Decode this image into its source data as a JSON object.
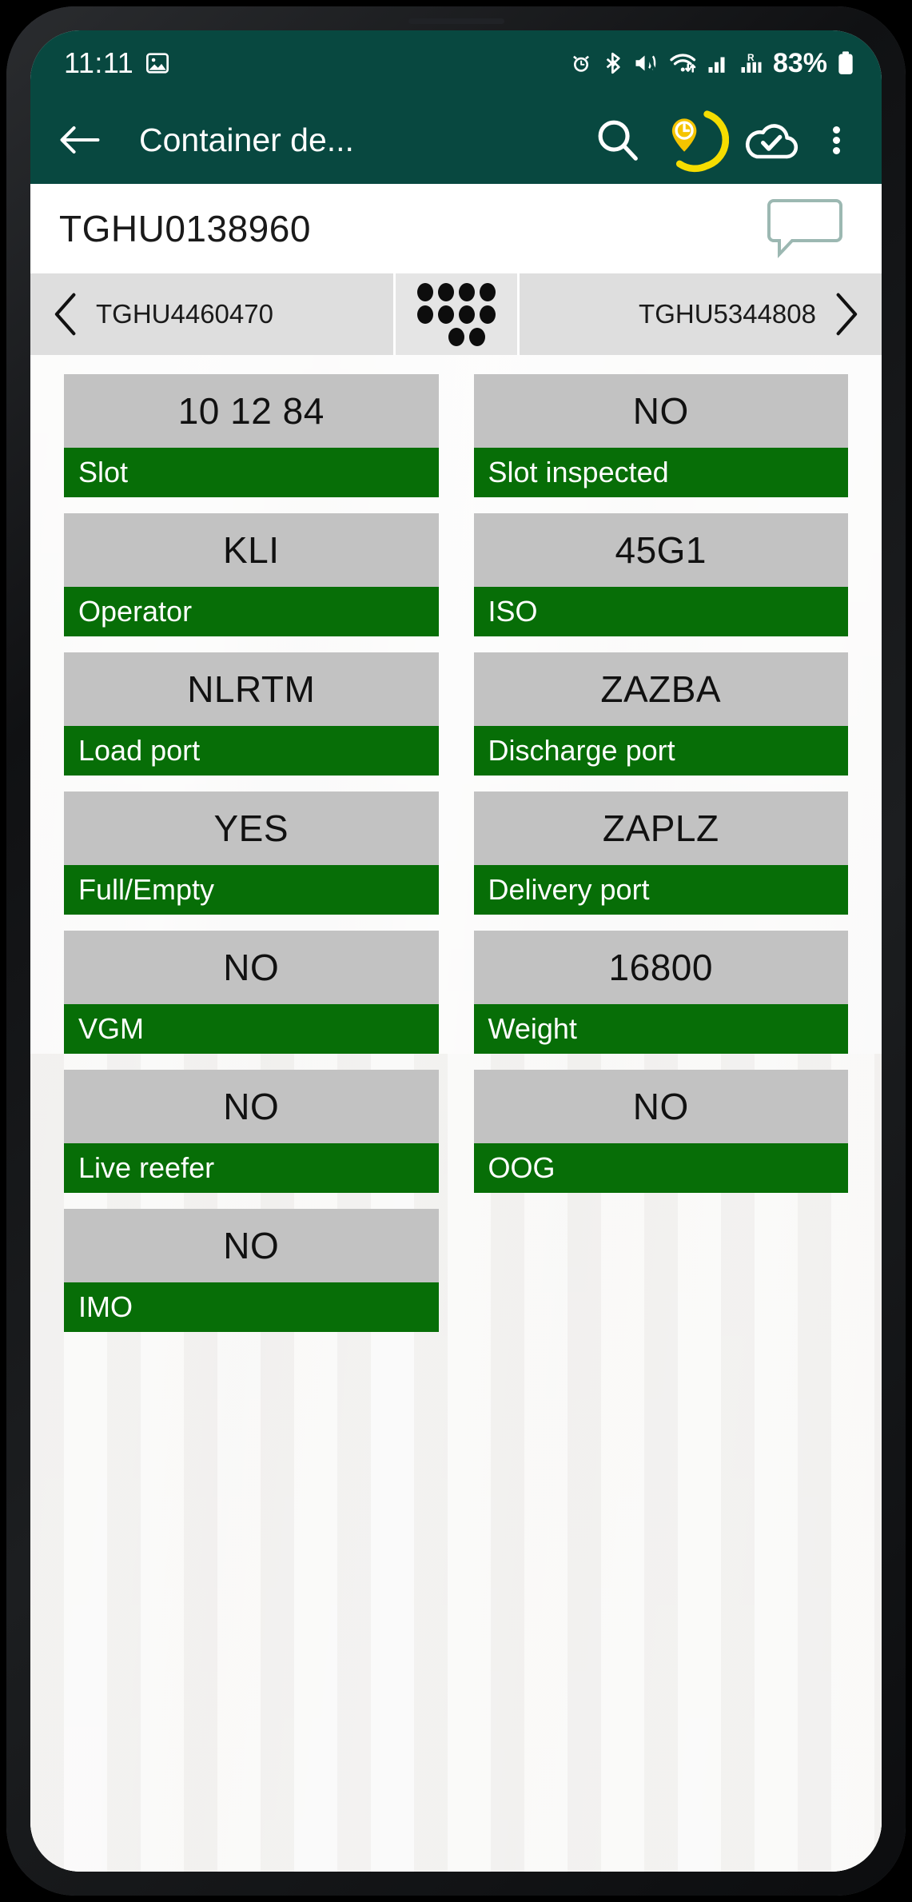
{
  "status_bar": {
    "time": "11:11",
    "battery_percent": "83%",
    "icons": [
      "image-icon",
      "alarm-icon",
      "bluetooth-icon",
      "mute-vibrate-icon",
      "wifi-icon",
      "signal-bars-icon",
      "roaming-signal-icon",
      "battery-icon"
    ]
  },
  "app_bar": {
    "title": "Container de...",
    "icons": [
      "back-arrow-icon",
      "search-icon",
      "location-clock-icon",
      "cloud-check-icon",
      "overflow-menu-icon"
    ],
    "accent_yellow": "#f5dd00",
    "background": "#084840"
  },
  "id_header": {
    "container_id": "TGHU0138960",
    "comment_icon": "speech-bubble-icon"
  },
  "nav_strip": {
    "previous_container": "TGHU4460470",
    "next_container": "TGHU5344808",
    "grid_icon": "dot-grid-icon"
  },
  "theme": {
    "label_green": "#076e07",
    "value_gray": "#c2c2c2",
    "toolbar_teal": "#084840"
  },
  "fields": [
    {
      "label": "Slot",
      "value": "10 12 84"
    },
    {
      "label": "Slot inspected",
      "value": "NO"
    },
    {
      "label": "Operator",
      "value": "KLI"
    },
    {
      "label": "ISO",
      "value": "45G1"
    },
    {
      "label": "Load port",
      "value": "NLRTM"
    },
    {
      "label": "Discharge port",
      "value": "ZAZBA"
    },
    {
      "label": "Full/Empty",
      "value": "YES"
    },
    {
      "label": "Delivery port",
      "value": "ZAPLZ"
    },
    {
      "label": "VGM",
      "value": "NO"
    },
    {
      "label": "Weight",
      "value": "16800"
    },
    {
      "label": "Live reefer",
      "value": "NO"
    },
    {
      "label": "OOG",
      "value": "NO"
    },
    {
      "label": "IMO",
      "value": "NO"
    }
  ]
}
